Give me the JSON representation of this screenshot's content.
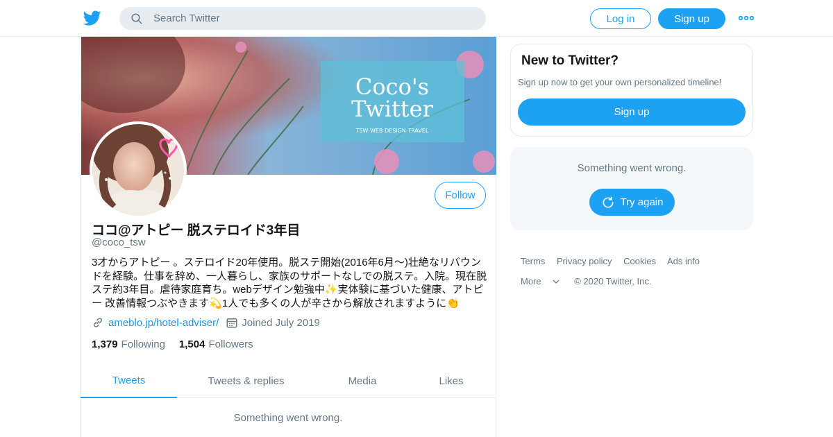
{
  "header": {
    "search_placeholder": "Search Twitter",
    "login_label": "Log in",
    "signup_label": "Sign up",
    "brand_color": "#1da1f2"
  },
  "banner": {
    "title": "Coco's Twitter",
    "subtitle": "TSW·WEB DESIGN·TRAVEL"
  },
  "profile": {
    "follow_label": "Follow",
    "name": "ココ@アトピー 脱ステロイド3年目",
    "handle": "@coco_tsw",
    "bio": "3才からアトピー 。ステロイド20年使用。脱ステ開始(2016年6月〜)壮絶なリバウンドを経験。仕事を辞め、一人暮らし、家族のサポートなしでの脱ステ。入院。現在脱ステ約3年目。虐待家庭育ち。webデザイン勉強中✨実体験に基づいた健康、アトピー 改善情報つぶやきます💫1人でも多くの人が辛さから解放されますように👏",
    "website": "ameblo.jp/hotel-adviser/",
    "joined": "Joined July 2019",
    "following_count": "1,379",
    "following_label": "Following",
    "followers_count": "1,504",
    "followers_label": "Followers"
  },
  "tabs": [
    {
      "label": "Tweets",
      "active": true
    },
    {
      "label": "Tweets & replies",
      "active": false
    },
    {
      "label": "Media",
      "active": false
    },
    {
      "label": "Likes",
      "active": false
    }
  ],
  "timeline": {
    "error": "Something went wrong."
  },
  "sidebar": {
    "new_title": "New to Twitter?",
    "new_sub": "Sign up now to get your own personalized timeline!",
    "new_button": "Sign up",
    "error_message": "Something went wrong.",
    "try_again": "Try again"
  },
  "footer": {
    "links": [
      "Terms",
      "Privacy policy",
      "Cookies",
      "Ads info",
      "More"
    ],
    "copyright": "© 2020 Twitter, Inc."
  }
}
